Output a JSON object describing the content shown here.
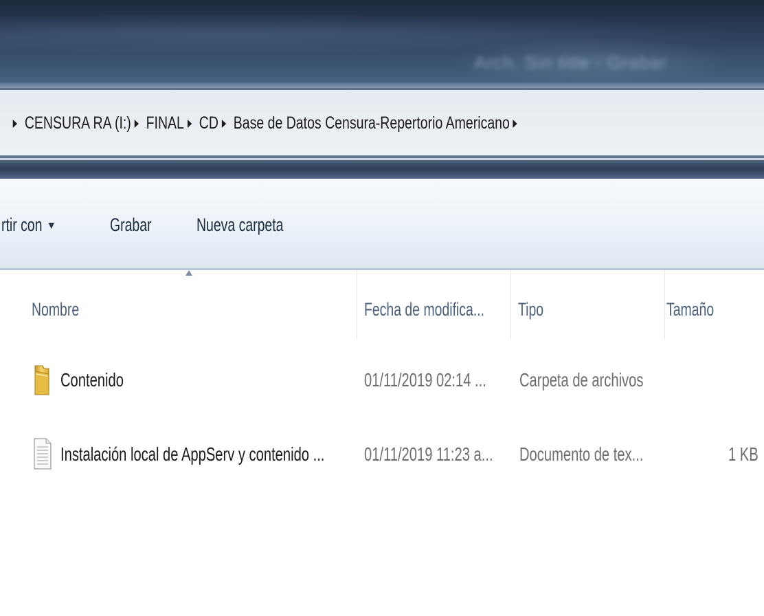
{
  "titlebar": {
    "blurred_text": "Arch. Sin title  ·  Grabar"
  },
  "address": {
    "crumbs": [
      "CENSURA RA (I:)",
      "FINAL",
      "CD",
      "Base de Datos Censura-Repertorio Americano"
    ]
  },
  "toolbar": {
    "share_label": "rtir con",
    "burn_label": "Grabar",
    "new_folder_label": "Nueva carpeta"
  },
  "columns": {
    "name": "Nombre",
    "date": "Fecha de modifica...",
    "type": "Tipo",
    "size": "Tamaño"
  },
  "files": [
    {
      "icon": "folder-icon",
      "name": "Contenido",
      "date": "01/11/2019 02:14 ...",
      "type": "Carpeta de archivos",
      "size": ""
    },
    {
      "icon": "text-document-icon",
      "name": "Instalación local de AppServ y contenido ...",
      "date": "01/11/2019 11:23 a...",
      "type": "Documento de tex...",
      "size": "1 KB"
    }
  ],
  "colors": {
    "titlebar": "#2a3d57",
    "header_text": "#4c607a",
    "toolbar_text": "#1c2b3c",
    "folder": "#e8c04a"
  }
}
